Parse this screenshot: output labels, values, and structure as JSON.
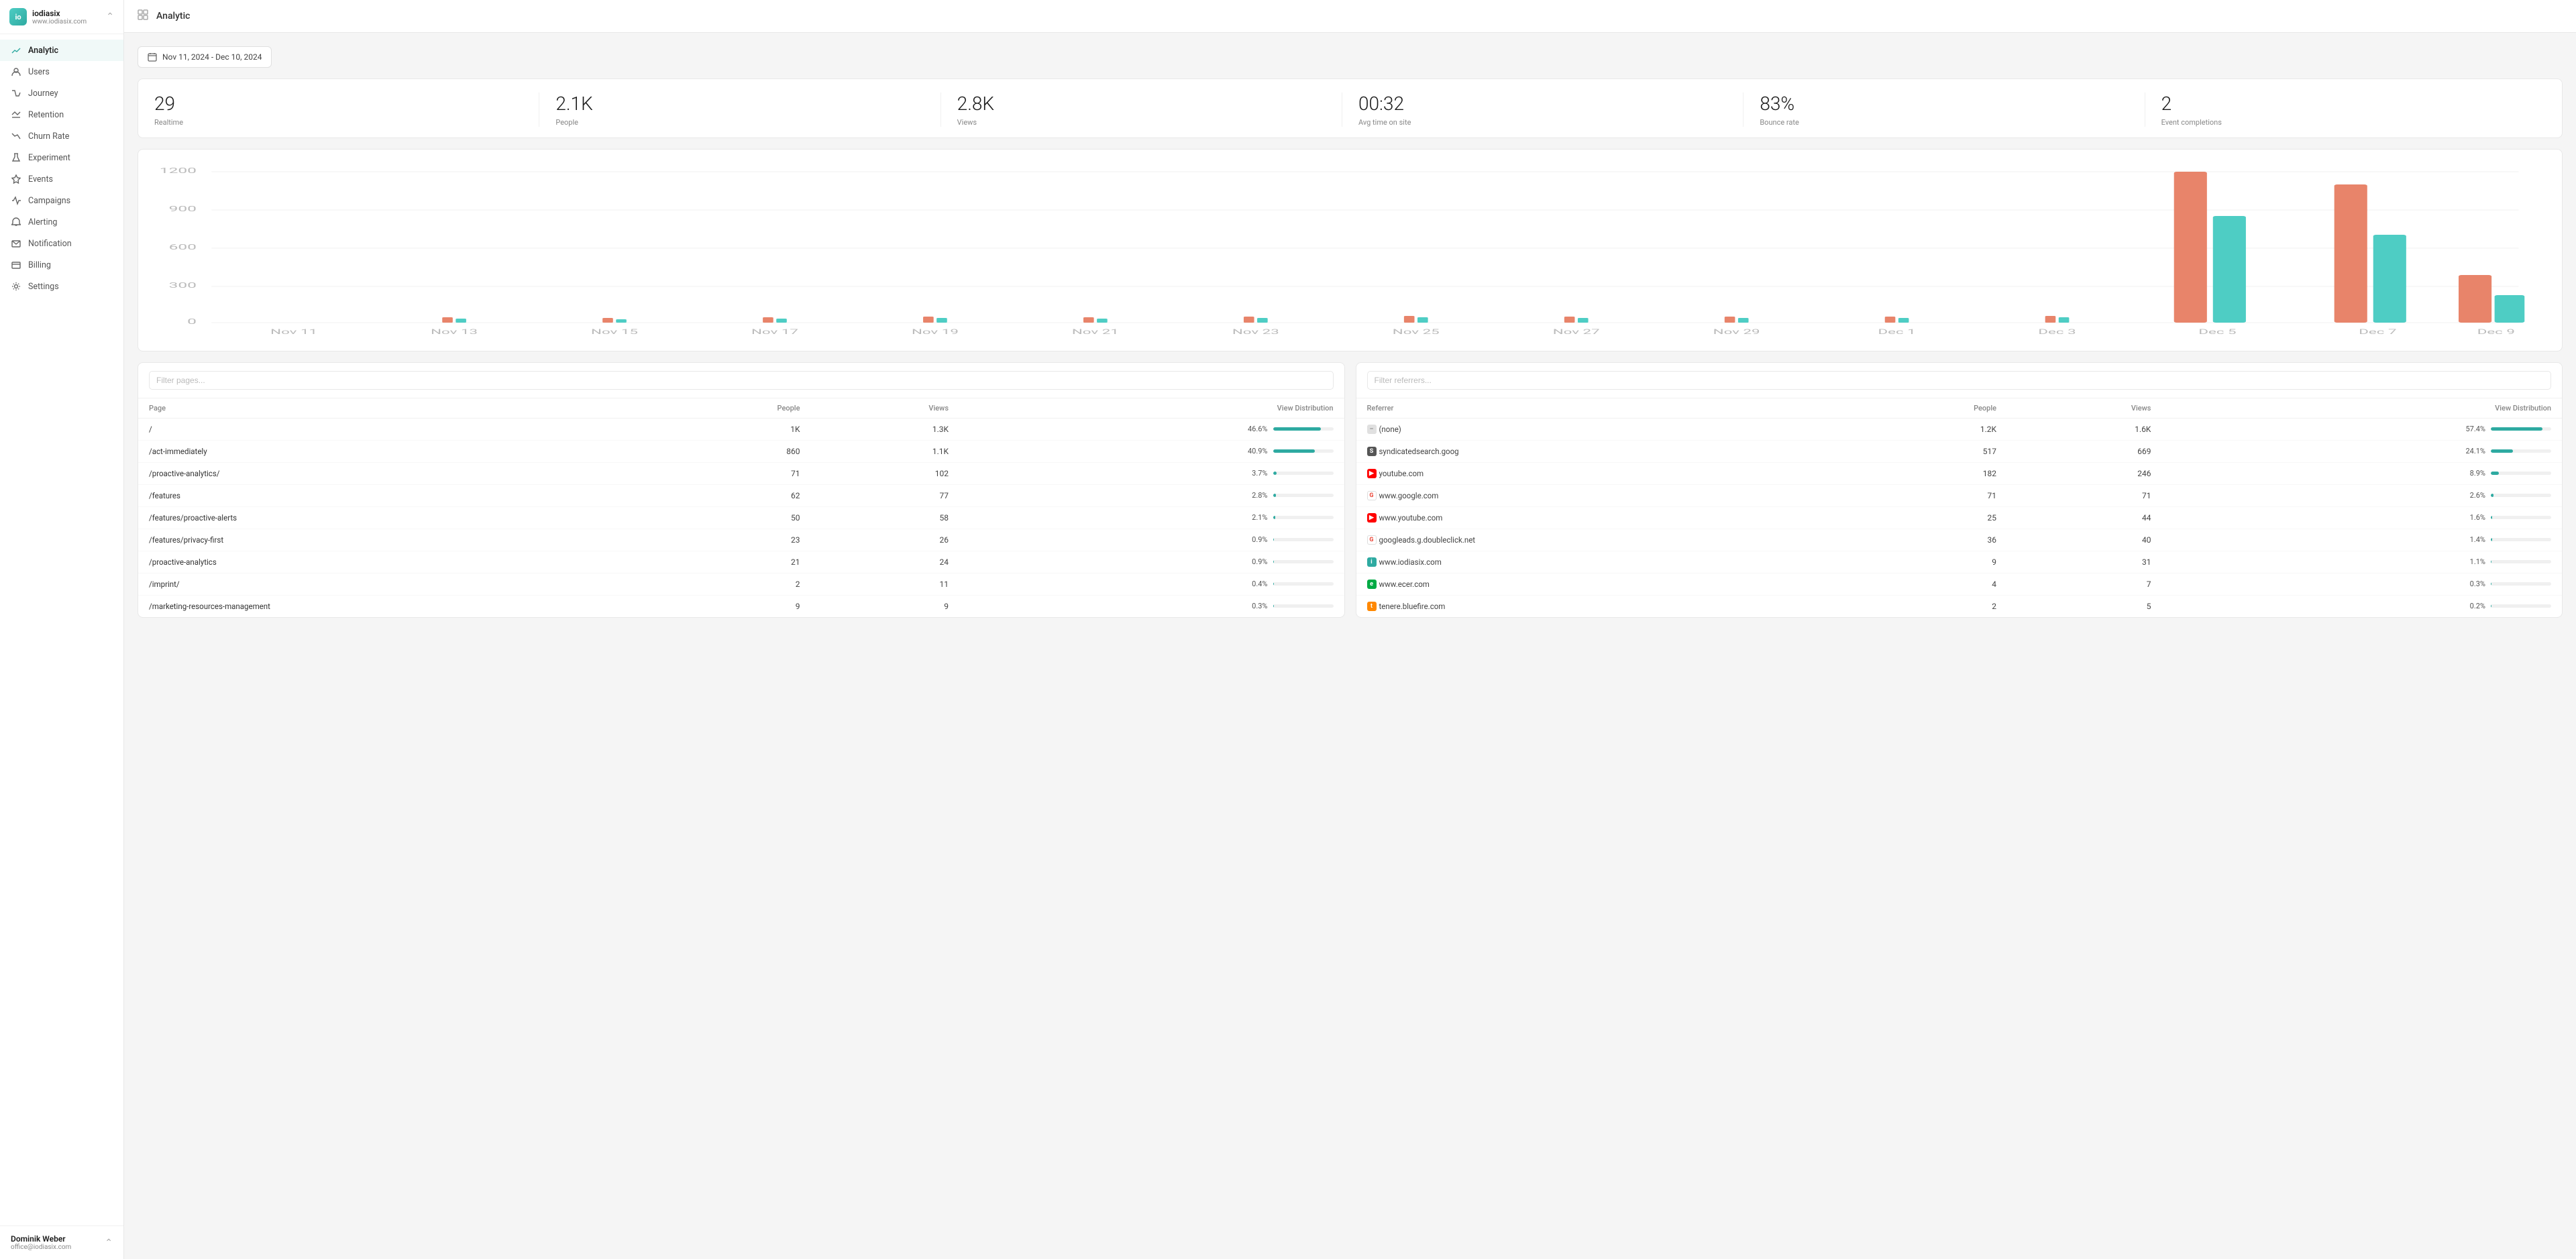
{
  "sidebar": {
    "brand": {
      "name": "iodiasix",
      "url": "www.iodiasix.com",
      "logo_text": "io"
    },
    "nav_items": [
      {
        "id": "analytic",
        "label": "Analytic",
        "icon": "chart-line",
        "active": true
      },
      {
        "id": "users",
        "label": "Users",
        "icon": "users",
        "active": false
      },
      {
        "id": "journey",
        "label": "Journey",
        "icon": "map",
        "active": false
      },
      {
        "id": "retention",
        "label": "Retention",
        "icon": "repeat",
        "active": false
      },
      {
        "id": "churn-rate",
        "label": "Churn Rate",
        "icon": "trending-down",
        "active": false
      },
      {
        "id": "experiment",
        "label": "Experiment",
        "icon": "flask",
        "active": false
      },
      {
        "id": "events",
        "label": "Events",
        "icon": "zap",
        "active": false
      },
      {
        "id": "campaigns",
        "label": "Campaigns",
        "icon": "megaphone",
        "active": false
      },
      {
        "id": "alerting",
        "label": "Alerting",
        "icon": "bell",
        "active": false
      },
      {
        "id": "notification",
        "label": "Notification",
        "icon": "notification",
        "active": false
      },
      {
        "id": "billing",
        "label": "Billing",
        "icon": "credit-card",
        "active": false
      },
      {
        "id": "settings",
        "label": "Settings",
        "icon": "settings",
        "active": false
      }
    ],
    "user": {
      "name": "Dominik Weber",
      "email": "office@iodiasix.com"
    }
  },
  "header": {
    "title": "Analytic",
    "icon": "grid"
  },
  "date_filter": {
    "label": "Nov 11, 2024 - Dec 10, 2024"
  },
  "stats": [
    {
      "value": "29",
      "label": "Realtime"
    },
    {
      "value": "2.1K",
      "label": "People"
    },
    {
      "value": "2.8K",
      "label": "Views"
    },
    {
      "value": "00:32",
      "label": "Avg time on site"
    },
    {
      "value": "83%",
      "label": "Bounce rate"
    },
    {
      "value": "2",
      "label": "Event completions"
    }
  ],
  "chart": {
    "y_labels": [
      "1200",
      "900",
      "600",
      "300",
      "0"
    ],
    "x_labels": [
      "Nov 11",
      "Nov 13",
      "Nov 15",
      "Nov 17",
      "Nov 19",
      "Nov 21",
      "Nov 23",
      "Nov 25",
      "Nov 27",
      "Nov 29",
      "Dec 1",
      "Dec 3",
      "Dec 5",
      "Dec 7",
      "Dec 9"
    ],
    "bars_data": [
      {
        "date": "Dec 5",
        "orange": 1300,
        "teal": 850
      },
      {
        "date": "Dec 7",
        "orange": 1100,
        "teal": 700
      },
      {
        "date": "Dec 9",
        "orange": 380,
        "teal": 220
      }
    ]
  },
  "pages_table": {
    "filter_placeholder": "Filter pages...",
    "columns": [
      "Page",
      "People",
      "Views",
      "View Distribution"
    ],
    "rows": [
      {
        "page": "/",
        "people": "1K",
        "views": "1.3K",
        "dist_label": "46.6%",
        "dist_pct": 46.6
      },
      {
        "page": "/act-immediately",
        "people": "860",
        "views": "1.1K",
        "dist_label": "40.9%",
        "dist_pct": 40.9
      },
      {
        "page": "/proactive-analytics/",
        "people": "71",
        "views": "102",
        "dist_label": "3.7%",
        "dist_pct": 3.7
      },
      {
        "page": "/features",
        "people": "62",
        "views": "77",
        "dist_label": "2.8%",
        "dist_pct": 2.8
      },
      {
        "page": "/features/proactive-alerts",
        "people": "50",
        "views": "58",
        "dist_label": "2.1%",
        "dist_pct": 2.1
      },
      {
        "page": "/features/privacy-first",
        "people": "23",
        "views": "26",
        "dist_label": "0.9%",
        "dist_pct": 0.9
      },
      {
        "page": "/proactive-analytics",
        "people": "21",
        "views": "24",
        "dist_label": "0.9%",
        "dist_pct": 0.9
      },
      {
        "page": "/imprint/",
        "people": "2",
        "views": "11",
        "dist_label": "0.4%",
        "dist_pct": 0.4
      },
      {
        "page": "/marketing-resources-management",
        "people": "9",
        "views": "9",
        "dist_label": "0.3%",
        "dist_pct": 0.3
      }
    ]
  },
  "referrers_table": {
    "filter_placeholder": "Filter referrers...",
    "columns": [
      "Referrer",
      "People",
      "Views",
      "View Distribution"
    ],
    "rows": [
      {
        "name": "(none)",
        "type": "none",
        "people": "1.2K",
        "views": "1.6K",
        "dist_label": "57.4%",
        "dist_pct": 57.4
      },
      {
        "name": "syndicatedsearch.goog",
        "type": "syndicated",
        "people": "517",
        "views": "669",
        "dist_label": "24.1%",
        "dist_pct": 24.1
      },
      {
        "name": "youtube.com",
        "type": "youtube",
        "people": "182",
        "views": "246",
        "dist_label": "8.9%",
        "dist_pct": 8.9
      },
      {
        "name": "www.google.com",
        "type": "google",
        "people": "71",
        "views": "71",
        "dist_label": "2.6%",
        "dist_pct": 2.6
      },
      {
        "name": "www.youtube.com",
        "type": "youtube",
        "people": "25",
        "views": "44",
        "dist_label": "1.6%",
        "dist_pct": 1.6
      },
      {
        "name": "googleads.g.doubleclick.net",
        "type": "google",
        "people": "36",
        "views": "40",
        "dist_label": "1.4%",
        "dist_pct": 1.4
      },
      {
        "name": "www.iodiasix.com",
        "type": "iodiasix",
        "people": "9",
        "views": "31",
        "dist_label": "1.1%",
        "dist_pct": 1.1
      },
      {
        "name": "www.ecer.com",
        "type": "ecer",
        "people": "4",
        "views": "7",
        "dist_label": "0.3%",
        "dist_pct": 0.3
      },
      {
        "name": "tenere.bluefire.com",
        "type": "tenere",
        "people": "2",
        "views": "5",
        "dist_label": "0.2%",
        "dist_pct": 0.2
      }
    ]
  }
}
